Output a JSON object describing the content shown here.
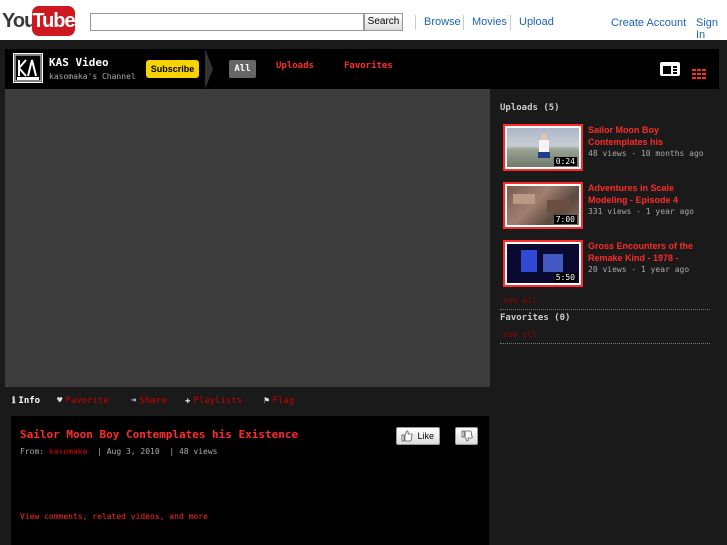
{
  "masthead": {
    "logo_you": "You",
    "logo_tube": "Tube",
    "search_value": "",
    "search_button": "Search",
    "nav": [
      "Browse",
      "Movies",
      "Upload"
    ],
    "create_account": "Create Account",
    "sign_in": "Sign In"
  },
  "channel": {
    "name": "KAS Video",
    "subtitle": "kasomaka's Channel",
    "subscribe": "Subscribe",
    "tabs": [
      "All",
      "Uploads",
      "Favorites"
    ]
  },
  "info_tabs": [
    "Info",
    "Favorite",
    "Share",
    "Playlists",
    "Flag"
  ],
  "video": {
    "title": "Sailor Moon Boy Contemplates his Existence",
    "from_label": "From: ",
    "author": "kasomaka",
    "date": "  | Aug 3, 2010",
    "views": "  | 48 views",
    "like": "Like",
    "more": "View comments, related videos, and more"
  },
  "sidebar": {
    "uploads_heading": "Uploads (5)",
    "uploads": [
      {
        "title": "Sailor Moon Boy Contemplates his",
        "stats": "48 views - 10 months ago",
        "duration": "0:24"
      },
      {
        "title": "Adventures in Scale Modeling - Episode 4",
        "stats": "331 views - 1 year ago",
        "duration": "7:00"
      },
      {
        "title": "Gross Encounters of the Remake Kind - 1978 -",
        "stats": "20 views - 1 year ago",
        "duration": "5:50"
      }
    ],
    "see_all": "see all",
    "favorites_heading": "Favorites (0)",
    "fav_see_all": "see all"
  }
}
